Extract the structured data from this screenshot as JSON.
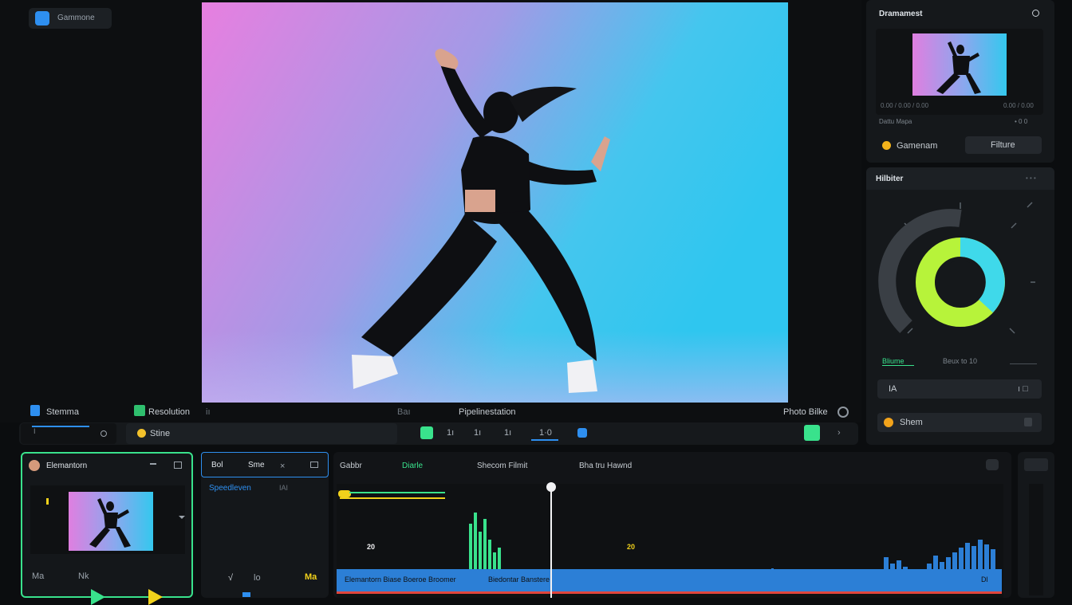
{
  "app": {
    "title_chip": "Gammone"
  },
  "viewer": {
    "bottom_left_label": "Stemma",
    "bottom_mid_label": "Resolution",
    "bottom_mid_small": "iı",
    "bottom_center_label": "Pipelinestation",
    "bottom_center_small": "Baı",
    "bottom_right_label": "Photo Bilke"
  },
  "controls": {
    "left_field_marker": "I",
    "left_field_icon": "search-small-icon",
    "chip_label": "Stine",
    "btn2": "1ı",
    "btn3": "1ı",
    "btn4": "1ı",
    "btn5": "1·0"
  },
  "right_top": {
    "header": "Dramamest",
    "thumb_left": "0.00 / 0.00 / 0.00",
    "thumb_right": "0.00 / 0.00",
    "footer_left": "Dattu Mapa",
    "footer_right": "• 0 0",
    "btn_primary": "Gamenam",
    "btn_secondary": "Filture"
  },
  "wheel_panel": {
    "header": "Hilbiter",
    "header_right": "• • •",
    "wheel_percent_green": 70,
    "wheel_percent_gray": 55,
    "label_left": "Bliume",
    "label_mid": "Beux to 10",
    "row1_left": "IA",
    "row1_right": "ı □",
    "row2_label": "Shem",
    "colors": {
      "green": "#b7f33a",
      "cyan": "#3fd9ea",
      "gray": "#3a3f45"
    }
  },
  "clip_panel": {
    "title": "Elemantorn",
    "bottom_a": "Ma",
    "bottom_b": "Nk"
  },
  "fx_panel": {
    "tab1": "Bol",
    "tab2": "Sme",
    "sub_label": "Speedleven",
    "sub_right": "IAI",
    "bottom_a": "√",
    "bottom_b": "lo",
    "bottom_c": "Ma"
  },
  "timeline": {
    "tab1": "Gabbr",
    "tab2": "Diarle",
    "tab3": "Shecom Filmit",
    "tab4": "Bha tru Hawnd",
    "clip_label_left": "Elemantorn Biase Boeroe Broomer",
    "clip_label_mid": "Biedontar Banstere",
    "clip_label_right": "Dl",
    "marker_left": "20",
    "marker_right": "20",
    "playhead_label": "",
    "colors": {
      "green": "#39e28c",
      "blue": "#2c7fd6",
      "yellow": "#f2d21b",
      "red": "#e0453d"
    }
  }
}
